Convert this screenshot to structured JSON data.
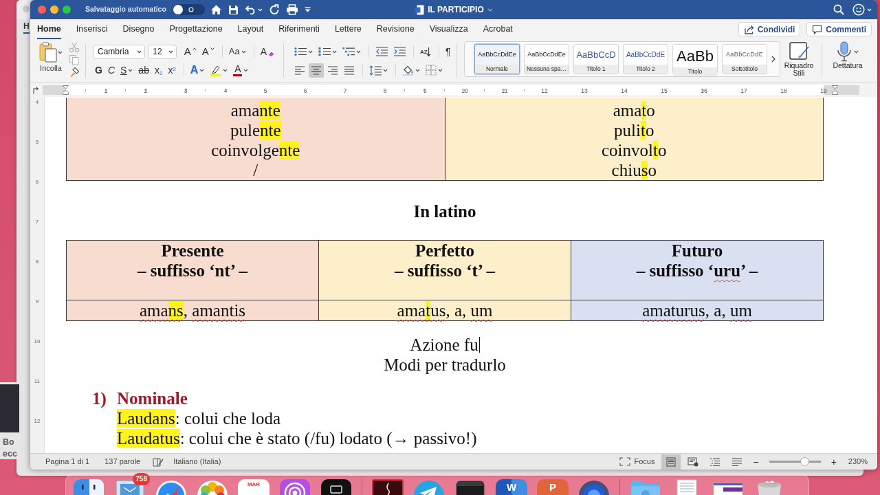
{
  "desktop": {
    "back_window": {
      "tab": "H"
    },
    "side_window": {
      "lines": [
        "Bo",
        "ecc"
      ]
    }
  },
  "window": {
    "title_bar": {
      "autosave_label": "Salvataggio automatico",
      "autosave_on": false,
      "title": "IL PARTICIPIO"
    },
    "tabs": [
      {
        "label": "Home",
        "selected": true
      },
      {
        "label": "Inserisci",
        "selected": false
      },
      {
        "label": "Disegno",
        "selected": false
      },
      {
        "label": "Progettazione",
        "selected": false
      },
      {
        "label": "Layout",
        "selected": false
      },
      {
        "label": "Riferimenti",
        "selected": false
      },
      {
        "label": "Lettere",
        "selected": false
      },
      {
        "label": "Revisione",
        "selected": false
      },
      {
        "label": "Visualizza",
        "selected": false
      },
      {
        "label": "Acrobat",
        "selected": false
      }
    ],
    "header_buttons": [
      {
        "kind": "share",
        "label": "Condividi"
      },
      {
        "kind": "comments",
        "label": "Commenti"
      }
    ],
    "ribbon": {
      "clipboard": {
        "paste_label": "Incolla",
        "tools": [
          {
            "kind": "cut",
            "disabled": true
          },
          {
            "kind": "copy",
            "disabled": true
          },
          {
            "kind": "format_painter",
            "disabled": false
          }
        ]
      },
      "font": {
        "family": "Cambria",
        "size": "12",
        "row1": [
          [
            {
              "kind": "grow",
              "label": "A",
              "menu": false,
              "selected": false
            },
            {
              "kind": "shrink",
              "label": "A",
              "menu": false,
              "selected": false
            }
          ],
          [
            {
              "kind": "case",
              "label": "Aa",
              "menu": true,
              "selected": false
            }
          ],
          [
            {
              "kind": "clear",
              "label": "A",
              "menu": false,
              "selected": false
            }
          ]
        ],
        "row2": [
          [
            {
              "kind": "bold",
              "label": "G",
              "menu": false,
              "selected": false
            },
            {
              "kind": "italic",
              "label": "C",
              "menu": false,
              "selected": false
            },
            {
              "kind": "underline",
              "label": "S",
              "menu": true,
              "selected": false
            },
            {
              "kind": "strike",
              "label": "ab",
              "menu": false,
              "selected": false
            },
            {
              "kind": "sub",
              "label": "x$_{2}$",
              "menu": false,
              "selected": false
            },
            {
              "kind": "sup",
              "label": "x$^{2}$",
              "menu": false,
              "selected": false
            }
          ],
          [
            {
              "kind": "effects",
              "label": "A",
              "menu": true,
              "selected": false
            },
            {
              "kind": "highlight",
              "menu": true,
              "selected": false
            },
            {
              "kind": "color",
              "label": "A",
              "menu": true,
              "selected": false
            }
          ]
        ]
      },
      "paragraph": {
        "row1": [
          [
            {
              "kind": "bullets",
              "menu": true,
              "selected": false
            },
            {
              "kind": "numbering",
              "menu": true,
              "selected": false
            },
            {
              "kind": "multilevel",
              "menu": true,
              "selected": false
            }
          ],
          [
            {
              "kind": "outdent",
              "menu": false,
              "selected": false
            },
            {
              "kind": "indent",
              "menu": false,
              "selected": false
            }
          ],
          [
            {
              "kind": "sort",
              "label": "AZ",
              "menu": false,
              "selected": false
            }
          ],
          [
            {
              "kind": "pilcrow",
              "label": "¶",
              "menu": false,
              "selected": false
            }
          ]
        ],
        "row2": [
          [
            {
              "kind": "align_left",
              "menu": false,
              "selected": false
            },
            {
              "kind": "align_center",
              "menu": false,
              "selected": true
            },
            {
              "kind": "align_right",
              "menu": false,
              "selected": false
            },
            {
              "kind": "justify",
              "menu": false,
              "selected": false
            }
          ],
          [
            {
              "kind": "line_spacing",
              "menu": true,
              "selected": false
            }
          ],
          [
            {
              "kind": "shading",
              "menu": true,
              "selected": false
            },
            {
              "kind": "borders",
              "menu": true,
              "selected": false
            }
          ]
        ]
      },
      "styles": [
        {
          "kind": "normal",
          "preview": "AaBbCcDdEe",
          "label": "Normale",
          "selected": true
        },
        {
          "kind": "no_spacing",
          "preview": "AaBbCcDdEe",
          "label": "Nessuna spa…",
          "selected": false
        },
        {
          "kind": "heading1",
          "preview": "AaBbCcD",
          "label": "Titolo 1",
          "selected": false
        },
        {
          "kind": "heading2",
          "preview": "AaBbCcDdE",
          "label": "Titolo 2",
          "selected": false
        },
        {
          "kind": "title",
          "preview": "AaBb",
          "label": "Titolo",
          "selected": false
        },
        {
          "kind": "subtitle",
          "preview": "AaBbCcDdE",
          "label": "Sottotitolo",
          "selected": false
        }
      ],
      "styles_pane": {
        "label": "Riquadro Stili"
      },
      "dictate": {
        "label": "Dettatura"
      }
    },
    "ruler": [
      "1",
      "2",
      "3",
      "4",
      "5",
      "6",
      "7",
      "8",
      "9",
      "10",
      "11",
      "12",
      "13",
      "14",
      "15",
      "16",
      "17",
      "18",
      "19"
    ],
    "vertical_ruler": [
      "4",
      "5",
      "6",
      "7",
      "8",
      "9",
      "10",
      "11",
      "12"
    ],
    "document": {
      "top_table": {
        "cells": [
          {
            "color": "#f8dccf",
            "lines": [
              [
                {
                  "text": "ama",
                  "highlight": false,
                  "misspelled": false
                },
                {
                  "text": "nte",
                  "highlight": true,
                  "misspelled": false
                }
              ],
              [
                {
                  "text": "pule",
                  "highlight": false,
                  "misspelled": false
                },
                {
                  "text": "nte",
                  "highlight": true,
                  "misspelled": false
                }
              ],
              [
                {
                  "text": "coinvolge",
                  "highlight": false,
                  "misspelled": false
                },
                {
                  "text": "nte",
                  "highlight": true,
                  "misspelled": false
                }
              ],
              [
                {
                  "text": "/",
                  "highlight": false,
                  "misspelled": false
                }
              ]
            ]
          },
          {
            "color": "#fcefc9",
            "lines": [
              [
                {
                  "text": "ama",
                  "highlight": false,
                  "misspelled": false
                },
                {
                  "text": "t",
                  "highlight": true,
                  "misspelled": false
                },
                {
                  "text": "o",
                  "highlight": false,
                  "misspelled": false
                }
              ],
              [
                {
                  "text": "puli",
                  "highlight": false,
                  "misspelled": false
                },
                {
                  "text": "t",
                  "highlight": true,
                  "misspelled": false
                },
                {
                  "text": "o",
                  "highlight": false,
                  "misspelled": false
                }
              ],
              [
                {
                  "text": "coinvol",
                  "highlight": false,
                  "misspelled": false
                },
                {
                  "text": "t",
                  "highlight": true,
                  "misspelled": false
                },
                {
                  "text": "o",
                  "highlight": false,
                  "misspelled": false
                }
              ],
              [
                {
                  "text": "chiu",
                  "highlight": false,
                  "misspelled": false
                },
                {
                  "text": "s",
                  "highlight": true,
                  "misspelled": false
                },
                {
                  "text": "o",
                  "highlight": false,
                  "misspelled": false
                }
              ]
            ]
          }
        ]
      },
      "heading": "In latino",
      "latin_table": {
        "columns": [
          {
            "color": "#f8dccf",
            "title": "Presente",
            "subtitle": [
              {
                "text": "– suffisso ‘nt’ –",
                "highlight": false,
                "misspelled": false
              }
            ],
            "cell": [
              {
                "text": "ama",
                "highlight": false,
                "misspelled": true
              },
              {
                "text": "ns",
                "highlight": true,
                "misspelled": true
              },
              {
                "text": ", ",
                "highlight": false,
                "misspelled": false
              },
              {
                "text": "amantis",
                "highlight": false,
                "misspelled": true
              }
            ]
          },
          {
            "color": "#fcefc9",
            "title": "Perfetto",
            "subtitle": [
              {
                "text": "– suffisso ‘t’ –",
                "highlight": false,
                "misspelled": false
              }
            ],
            "cell": [
              {
                "text": "ama",
                "highlight": false,
                "misspelled": true
              },
              {
                "text": "t",
                "highlight": true,
                "misspelled": true
              },
              {
                "text": "us",
                "highlight": false,
                "misspelled": true
              },
              {
                "text": ", a, ",
                "highlight": false,
                "misspelled": false
              },
              {
                "text": "um",
                "highlight": false,
                "misspelled": true
              }
            ]
          },
          {
            "color": "#d9e0f2",
            "title": "Futuro",
            "subtitle": [
              {
                "text": "– suffisso ‘",
                "highlight": false,
                "misspelled": false
              },
              {
                "text": "uru",
                "highlight": false,
                "misspelled": true
              },
              {
                "text": "’ –",
                "highlight": false,
                "misspelled": false
              }
            ],
            "cell": [
              {
                "text": "amaturus",
                "highlight": false,
                "misspelled": true
              },
              {
                "text": ", a, ",
                "highlight": false,
                "misspelled": false
              },
              {
                "text": "um",
                "highlight": false,
                "misspelled": true
              }
            ]
          }
        ]
      },
      "center_lines": [
        {
          "text": "Azione fu",
          "cursor": true
        },
        {
          "text": "Modi per tradurlo",
          "cursor": false
        }
      ],
      "list": [
        {
          "number": "1)",
          "title": "Nominale",
          "lines": [
            [
              {
                "text": "Laudans",
                "highlight": true,
                "misspelled": false
              },
              {
                "text": ": colui che loda",
                "highlight": false,
                "misspelled": false
              }
            ],
            [
              {
                "text": "Laudatus",
                "highlight": true,
                "misspelled": false
              },
              {
                "text": ": colui che è stato (/fu) lodato (→ passivo!)",
                "highlight": false,
                "misspelled": false
              }
            ]
          ]
        }
      ]
    },
    "status_bar": {
      "page": "Pagina 1 di 1",
      "words": "137 parole",
      "language": "Italiano (Italia)",
      "focus": "Focus",
      "views": [
        {
          "kind": "print_layout",
          "selected": true
        },
        {
          "kind": "web_layout",
          "selected": false
        },
        {
          "kind": "outline",
          "selected": false
        },
        {
          "kind": "draft",
          "selected": false
        }
      ],
      "zoom_out": "−",
      "zoom_in": "+",
      "zoom": {
        "level": 0.73,
        "reading": "230%"
      }
    }
  },
  "dock": [
    {
      "kind": "finder"
    },
    {
      "kind": "mail",
      "badge": "758"
    },
    {
      "kind": "safari"
    },
    {
      "kind": "photos"
    },
    {
      "kind": "calendar",
      "label": "MAR"
    },
    {
      "kind": "podcasts"
    },
    {
      "kind": "tv"
    },
    {
      "kind": "separator"
    },
    {
      "kind": "dark_app"
    },
    {
      "kind": "telegram"
    },
    {
      "kind": "terminal"
    },
    {
      "kind": "word",
      "label": "W"
    },
    {
      "kind": "powerpoint",
      "label": "P"
    },
    {
      "kind": "blue_circle"
    },
    {
      "kind": "separator"
    },
    {
      "kind": "folder"
    },
    {
      "kind": "document"
    },
    {
      "kind": "screenshot"
    },
    {
      "kind": "trash"
    }
  ]
}
